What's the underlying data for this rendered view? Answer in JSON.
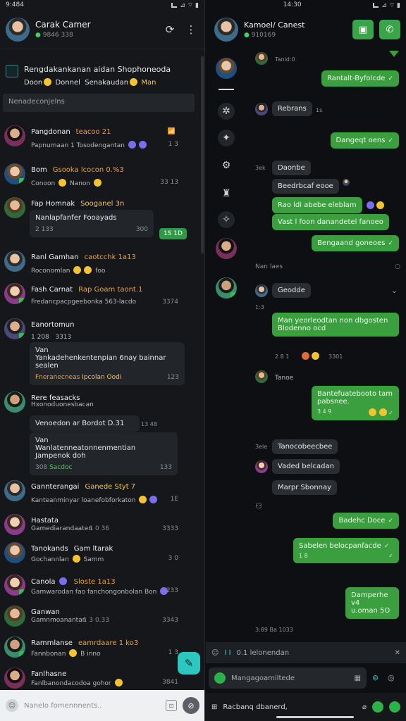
{
  "left": {
    "status": {
      "time": "9:484",
      "icons": "⊿ ⌔ ▮"
    },
    "header": {
      "name": "Carak Camer",
      "sub": "9846 338"
    },
    "announcement": {
      "line1": "Rengdakankanan aidan Shophoneoda",
      "line2a": "Doon",
      "line2b": "Donnel",
      "line2c": "Senakaudan",
      "line2d": "Man"
    },
    "search_placeholder": "Nenadeconjelns",
    "rows": [
      {
        "name": "Pangdonan",
        "tag": "teacoo 21",
        "preview": "Papnumaan 1 Tosodengantan",
        "meta": "1 3",
        "badge": "📶"
      },
      {
        "name": "Bom",
        "tag": "Gsooka  lcocon 0.%3",
        "preview": "Conoon",
        "preview2": "Nanon",
        "meta": "33 13"
      },
      {
        "name": "Fap Homnak",
        "tag": "Sooganel 3n",
        "card_text": "Nanlapfanfer Fooayads",
        "card_meta": "2 133",
        "card_meta2": "300",
        "pill": "1S 1D"
      },
      {
        "name": "Ranl Gamhan",
        "tag": "caotcchk  1a13",
        "preview": "Roconomlan",
        "preview2": "foo"
      },
      {
        "name": "Fash Carnat",
        "tag": "Rap Goam   taont.1",
        "preview": "Fredancpacpgeebonka 563-lacdo",
        "meta": "3374"
      },
      {
        "name": "Eanortomun",
        "tag": "1 208",
        "tag2": "3313",
        "card_l1": "Van",
        "card_l2": "Yankadehenkentenpian 6nay bainnar",
        "card_l3": "sealen",
        "card_l4a": "Fneranecneas",
        "card_l4b": "Ipcolan Oodi",
        "card_meta": "123"
      },
      {
        "name": "Rere feasacks",
        "preview": "Hxonoduonesbacan",
        "card_l1": "Venoedon",
        "card_l1b": "ar Bordot  D.31",
        "card_time": "13 48",
        "card_l2": "Van",
        "card_l3": "Wanlatenneatonnenmentian Jampenok doh",
        "card_meta": "308",
        "card_meta_b": "Sacdoc",
        "card_meta2": "133"
      },
      {
        "name": "Gannterangai",
        "tag": "Ganede Styt 7",
        "preview": "Kanteanminyar loanefobforkaton",
        "meta": "1E"
      },
      {
        "name": "Hastata",
        "preview": "Gamediarandaaten",
        "meta": "1 0 36",
        "meta2": "3333"
      },
      {
        "name": "Tanokands",
        "tag": "Gam ltarak",
        "preview": "Gochannlan",
        "preview2": "Samm",
        "meta": "3 0"
      },
      {
        "name": "Canola",
        "tag": "Sloste",
        "tag2": "1a13",
        "preview": "Gamwarodan fao fanchongonbolan Bon",
        "meta": "233"
      },
      {
        "name": "Ganwan",
        "preview": "Gamnmoanantan",
        "meta": "1 3 0.33",
        "meta2": "3343"
      },
      {
        "name": "Rammlanse",
        "tag": "eamrdaare",
        "tag2": "1 ko3",
        "preview": "Fannbonan",
        "preview2": "B inno",
        "meta": "1 3"
      },
      {
        "name": "Fanlhasne",
        "preview": "Fanlbanondacodoa gohor",
        "meta": "3841"
      }
    ],
    "bottom_placeholder": "Nanelo fomennnents..",
    "fab_icon": "chat-plus-icon"
  },
  "right": {
    "status": {
      "time": "14:30",
      "icons": "⊿ ⌔ ▮"
    },
    "header": {
      "name": "Kamoel/ Canest",
      "sub": "910169"
    },
    "messages": {
      "m1_time": "Tanid:0",
      "m1_out": "Rantalt-Byfolcde",
      "m2_in": "Rebrans",
      "m2_time": "1s",
      "m3_out": "Dangeqt oens",
      "m4_time": "3ek",
      "m4_in": "Daonbe",
      "m5_in": "Beedrbcaf eooe",
      "m6_out": "Rao ldi abebe eleblam",
      "m7_out": "Vast l foon danandetel fanoeo",
      "m8_out": "Bengaand goneoes",
      "sep1_label": "Nan laes",
      "m9_in": "Geodde",
      "m9_time": "1:3",
      "m10_out_l1": "Man yeorleodtan non dbgosten",
      "m10_out_l2": "Blodenno ocd",
      "m10_time": "2 8 1",
      "m10_time2": "3301",
      "m11_name": "Tanoe",
      "m12_out_l1": "Bantefuatebooto tam",
      "m12_out_l2": "pabsnee.",
      "m12_time": "3 4 9",
      "m13_time": "3ele",
      "m13_in": "Tanocobeecbee",
      "m14_in": "Vaded belcadan",
      "m15_in": "Marpr Sbonnay",
      "m16_out": "Badehc Doce",
      "m17_out": "Sabelen belocpanfacde",
      "m17_sub": "1 8",
      "m18_out_l1": "Damperhe v4",
      "m18_out_l2": "u.oman 5O",
      "bottom_time": "3:89  Ba 1033"
    },
    "input_row1": "0.1 lelonendan",
    "input_row2": "Mangagoamiltede",
    "bottom_bar": "Racbanq dbanerd,"
  }
}
